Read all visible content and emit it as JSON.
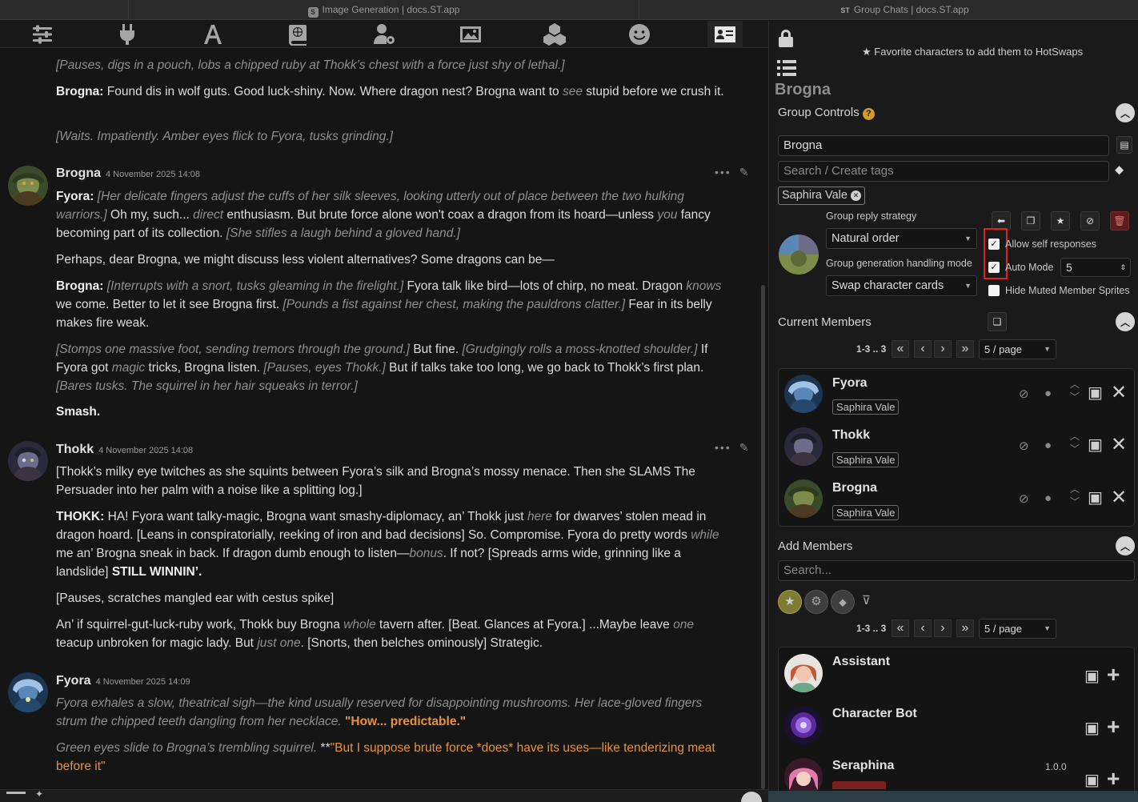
{
  "tabs": [
    {
      "label": "Image Generation | docs.ST.app",
      "icon": "S"
    },
    {
      "label": "Group Chats | docs.ST.app",
      "icon": "ST"
    }
  ],
  "nav_icons": [
    "ai-response-config-icon",
    "api-connections-icon",
    "advanced-formatting-icon",
    "world-info-icon",
    "user-settings-icon",
    "backgrounds-icon",
    "extensions-icon",
    "persona-management-icon",
    "character-management-icon"
  ],
  "chat": {
    "top_lines": [
      "[Pauses, digs in a pouch, lobs a chipped ruby at Thokk’s chest with a force just shy of lethal.]",
      "[Waits. Impatiently. Amber eyes flick to Fyora, tusks grinding.]"
    ],
    "top_brogna_speaker": "Brogna:",
    "top_brogna_text1": "Found dis in wolf guts. Good luck-shiny. Now. Where dragon nest? Brogna want to",
    "top_brogna_em": "see",
    "top_brogna_text2": "stupid before we crush it.",
    "messages": [
      {
        "name": "Brogna",
        "date": "4 November 2025 14:08"
      },
      {
        "name": "Thokk",
        "date": "4 November 2025 14:08"
      },
      {
        "name": "Fyora",
        "date": "4 November 2025 14:09"
      }
    ],
    "m1": {
      "fyora": "Fyora:",
      "t1": "[Her delicate fingers adjust the cuffs of her silk sleeves, looking utterly out of place between the two hulking warriors.]",
      "t2": "Oh my, such...",
      "t3": "direct",
      "t4": "enthusiasm. But brute force alone won't coax a dragon from its hoard—unless",
      "t5": "you",
      "t6": "fancy becoming part of its collection.",
      "t7": "[She stifles a laugh behind a gloved hand.]",
      "p2": "Perhaps, dear Brogna, we might discuss less violent alternatives? Some dragons can be—",
      "brogna": "Brogna:",
      "t8": "[Interrupts with a snort, tusks gleaming in the firelight.]",
      "t9": "Fyora talk like bird—lots of chirp, no meat. Dragon",
      "t10": "knows",
      "t11": "we come. Better to let it see Brogna first.",
      "t12": "[Pounds a fist against her chest, making the pauldrons clatter.]",
      "t13": "Fear in its belly makes fire weak.",
      "t14": "[Stomps one massive foot, sending tremors through the ground.]",
      "t15": "But fine.",
      "t16": "[Grudgingly rolls a moss-knotted shoulder.]",
      "t17": "If Fyora got",
      "t18": "magic",
      "t19": "tricks, Brogna listen.",
      "t20": "[Pauses, eyes Thokk.]",
      "t21": "But if talks take too long, we go back to Thokk’s first plan.",
      "t22": "[Bares tusks. The squirrel in her hair squeaks in terror.]",
      "t23": "Smash."
    },
    "m2": {
      "p1": "[Thokk’s milky eye twitches as she squints between Fyora’s silk and Brogna’s mossy menace. Then she SLAMS The Persuader into her palm with a noise like a splitting log.]",
      "thokk": "THOKK:",
      "t1": "HA! Fyora want talky-magic, Brogna want smashy-diplomacy, an’ Thokk just",
      "t2": "here",
      "t3": "for dwarves’ stolen mead in dragon hoard. [Leans in conspiratorially, reeking of iron and bad decisions] So. Compromise. Fyora do pretty words",
      "t4": "while",
      "t5": "me an’ Brogna sneak in back. If dragon dumb enough to listen—",
      "t6": "bonus",
      "t7": ". If not? [Spreads arms wide, grinning like a landslide]",
      "t8": "STILL WINNIN’.",
      "p3": "[Pauses, scratches mangled ear with cestus spike]",
      "t9": "An’ if squirrel-gut-luck-ruby work, Thokk buy Brogna",
      "t10": "whole",
      "t11": "tavern after. [Beat. Glances at Fyora.] ...Maybe leave",
      "t12": "one",
      "t13": "teacup unbroken for magic lady. But",
      "t14": "just one",
      "t15": ". [Snorts, then belches ominously] Strategic."
    },
    "m3": {
      "t1": "Fyora exhales a slow, theatrical sigh—the kind usually reserved for disappointing mushrooms. Her lace-gloved fingers strum the chipped teeth dangling from her necklace.",
      "t2": "\"How... predictable.\"",
      "t3": "Green eyes slide to Brogna’s trembling squirrel.",
      "t4": "**",
      "t5": "\"But I suppose brute force *does* have its uses—like tenderizing meat before it\""
    }
  },
  "panel": {
    "hotswap_text": "Favorite characters to add them to HotSwaps",
    "char_title": "Brogna",
    "group_controls": "Group Controls",
    "group_name": "Brogna",
    "tag_search_placeholder": "Search / Create tags",
    "tag_chip": "Saphira Vale",
    "reply_strategy_label": "Group reply strategy",
    "reply_strategy_value": "Natural order",
    "gen_mode_label": "Group generation handling mode",
    "gen_mode_value": "Swap character cards",
    "allow_self": "Allow self responses",
    "auto_mode": "Auto Mode",
    "auto_mode_value": "5",
    "hide_muted": "Hide Muted Member Sprites",
    "current_members": "Current Members",
    "pager_range": "1-3 .. 3",
    "page_size": "5 / page",
    "members": [
      {
        "name": "Fyora",
        "tag": "Saphira Vale"
      },
      {
        "name": "Thokk",
        "tag": "Saphira Vale"
      },
      {
        "name": "Brogna",
        "tag": "Saphira Vale"
      }
    ],
    "add_members": "Add Members",
    "add_search_placeholder": "Search...",
    "add_pager_range": "1-3 .. 3",
    "add_page_size": "5 / page",
    "candidates": [
      {
        "name": "Assistant",
        "version": ""
      },
      {
        "name": "Character Bot",
        "version": ""
      },
      {
        "name": "Seraphina",
        "version": "1.0.0"
      }
    ]
  }
}
